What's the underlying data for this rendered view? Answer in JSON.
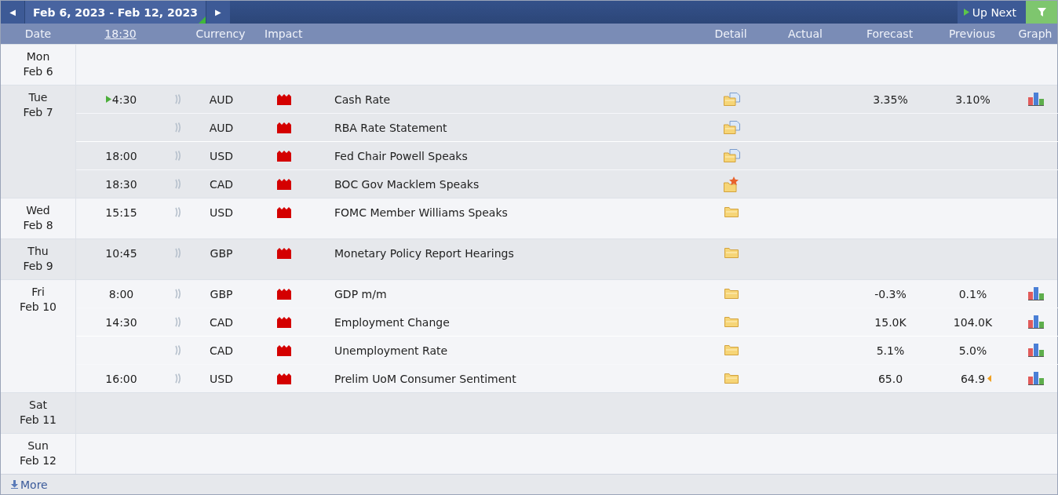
{
  "toolbar": {
    "prev_label": "◀",
    "range": "Feb 6, 2023 - Feb 12, 2023",
    "next_label": "▶",
    "up_next": "Up Next"
  },
  "columns": {
    "date": "Date",
    "time": "18:30",
    "currency": "Currency",
    "impact": "Impact",
    "detail": "Detail",
    "actual": "Actual",
    "forecast": "Forecast",
    "previous": "Previous",
    "graph": "Graph"
  },
  "days": [
    {
      "day": "Mon",
      "date": "Feb 6"
    },
    {
      "day": "Tue",
      "date": "Feb 7",
      "events": [
        {
          "time": "4:30",
          "up_next": true,
          "currency": "AUD",
          "color": "#d40000",
          "title": "Cash Rate",
          "kind": "document",
          "forecast": "3.35%",
          "previous": "3.10%",
          "graph": true
        },
        {
          "currency": "AUD",
          "color": "#d40000",
          "title": "RBA Rate Statement",
          "kind": "document"
        },
        {
          "time": "18:00",
          "currency": "USD",
          "color": "#d40000",
          "title": "Fed Chair Powell Speaks",
          "kind": "document"
        },
        {
          "time": "18:30",
          "currency": "CAD",
          "color": "#d40000",
          "title": "BOC Gov Macklem Speaks",
          "kind": "star"
        }
      ]
    },
    {
      "day": "Wed",
      "date": "Feb 8",
      "events": [
        {
          "time": "15:15",
          "currency": "USD",
          "color": "#d40000",
          "title": "FOMC Member Williams Speaks",
          "kind": "folder"
        }
      ]
    },
    {
      "day": "Thu",
      "date": "Feb 9",
      "events": [
        {
          "time": "10:45",
          "currency": "GBP",
          "color": "#d40000",
          "title": "Monetary Policy Report Hearings",
          "kind": "folder"
        }
      ]
    },
    {
      "day": "Fri",
      "date": "Feb 10",
      "events": [
        {
          "time": "8:00",
          "currency": "GBP",
          "color": "#d40000",
          "title": "GDP m/m",
          "kind": "folder",
          "forecast": "-0.3%",
          "previous": "0.1%",
          "graph": true
        },
        {
          "time": "14:30",
          "currency": "CAD",
          "color": "#d40000",
          "title": "Employment Change",
          "kind": "folder",
          "forecast": "15.0K",
          "previous": "104.0K",
          "graph": true
        },
        {
          "currency": "CAD",
          "color": "#d40000",
          "title": "Unemployment Rate",
          "kind": "folder",
          "forecast": "5.1%",
          "previous": "5.0%",
          "graph": true
        },
        {
          "time": "16:00",
          "currency": "USD",
          "color": "#d40000",
          "title": "Prelim UoM Consumer Sentiment",
          "kind": "folder",
          "forecast": "65.0",
          "previous": "64.9",
          "revised": true,
          "graph": true
        }
      ]
    },
    {
      "day": "Sat",
      "date": "Feb 11"
    },
    {
      "day": "Sun",
      "date": "Feb 12"
    }
  ],
  "more": "More"
}
